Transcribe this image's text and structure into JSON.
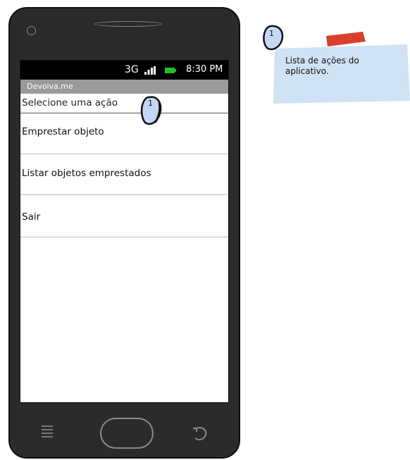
{
  "status_bar": {
    "network": "3G",
    "time": "8:30 PM",
    "battery_color": "#22c022"
  },
  "app": {
    "title": "Devolva.me"
  },
  "list": {
    "header": "Selecione uma ação",
    "items": [
      {
        "label": "Emprestar objeto"
      },
      {
        "label": "Listar objetos emprestados"
      },
      {
        "label": "Sair"
      }
    ]
  },
  "callout": {
    "number": "1"
  },
  "note": {
    "number": "1",
    "text": "Lista de ações do aplicativo.",
    "paper_color": "#cfe3f5",
    "tape_color": "#d9402b"
  },
  "colors": {
    "phone_body": "#2b2b2b",
    "title_bar": "#9a9a9a",
    "badge_fill": "#c6d7f5"
  }
}
